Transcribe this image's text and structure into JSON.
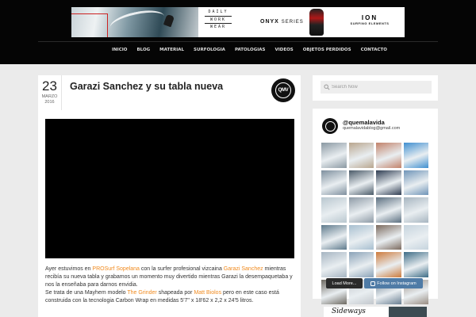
{
  "header": {
    "banner": {
      "dww_words": [
        "DAILY",
        "WORK",
        "WEAR"
      ],
      "onyx_brand": "ONYX",
      "onyx_series": "SERIES",
      "ion_mark": "ION",
      "ion_tagline": "SURFING ELEMENTS"
    },
    "nav": [
      "Inicio",
      "Blog",
      "Material",
      "Surfologia",
      "Patologias",
      "Videos",
      "Objetos Perdidos",
      "Contacto"
    ]
  },
  "post": {
    "date": {
      "day": "23",
      "month": "Marzo",
      "year": "2016"
    },
    "title": "Garazi Sanchez y su tabla nueva",
    "logo_text": "QMV",
    "body": {
      "p1_a": "Ayer estuvimos en ",
      "p1_link1": "PROSurf Sopelana",
      "p1_b": " con la surfer profesional vizcaina ",
      "p1_link2": "Garazi Sanchez",
      "p1_c": " mientras recibía su nueva tabla y grabamos un momento muy divertido mientras Garazi la desempaquetaba y nos la enseñaba para darnos envidia.",
      "p2_a": "Se trata de una Mayhem modelo ",
      "p2_link1": "The Grinder",
      "p2_b": " shapeada por ",
      "p2_link2": "Matt Biolos",
      "p2_c": " pero en este caso está construida con la tecnologia Carbon Wrap  en medidas 5'7\" x 18'62 x  2,2 x 24'5 litros."
    }
  },
  "sidebar": {
    "search": {
      "placeholder": "Search Now"
    },
    "instagram": {
      "handle": "@quemalavida",
      "email": "quemalavidablog@gmail.com",
      "tiles": [
        "#8a98a2",
        "#b9a68e",
        "#c2826a",
        "#3f8fd0",
        "#7e8f9e",
        "#4a5a68",
        "#2f3d52",
        "#6f94b8",
        "#b9c7cf",
        "#8d9aa6",
        "#5b6f80",
        "#a7b5c0",
        "#5e7a8c",
        "#a7bfd0",
        "#7b6a5e",
        "#c6d4de",
        "#a6b5c2",
        "#8aa2b8",
        "#cd7b3c",
        "#3d6c86",
        "#6e6a62",
        "#c2c7cc",
        "#6a7f92",
        "#9a8e84"
      ],
      "load_more": "Load More...",
      "follow": "Follow on Instagram"
    }
  },
  "ad": {
    "script_text": "Sideways"
  }
}
